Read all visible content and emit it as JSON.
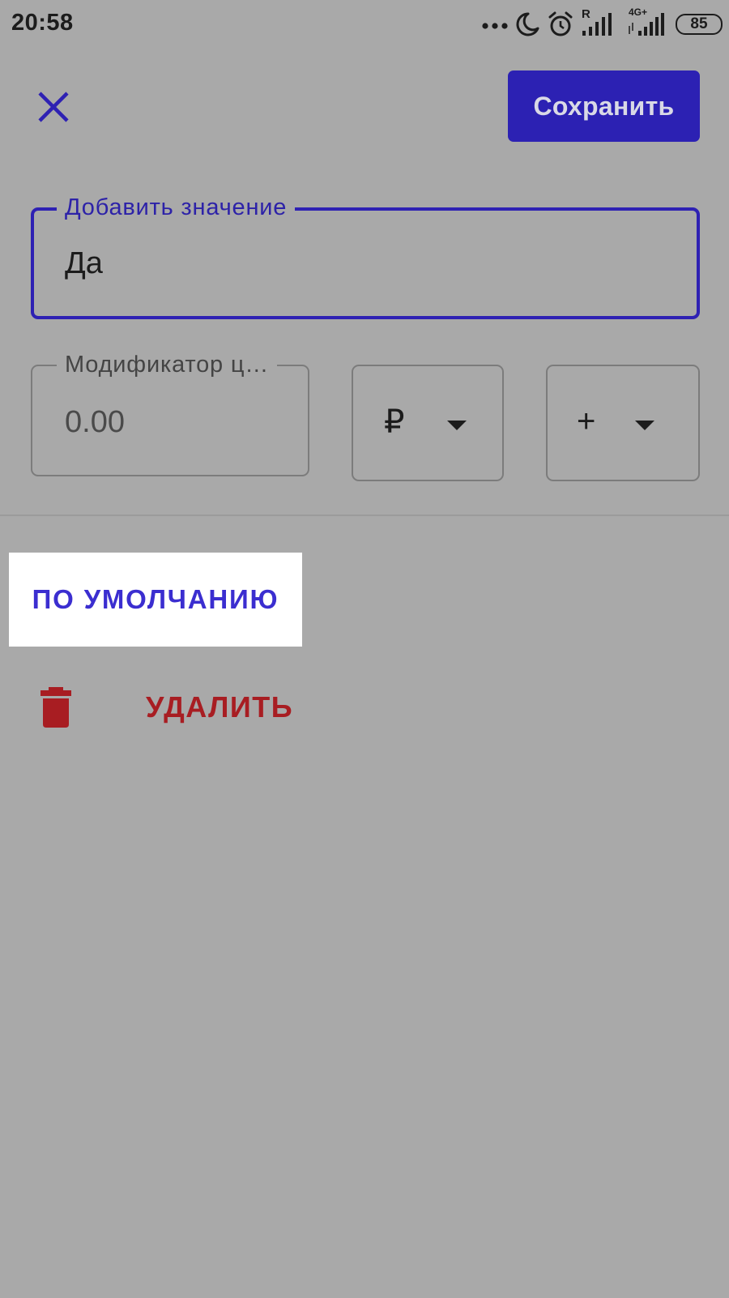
{
  "status_bar": {
    "time": "20:58",
    "icons": [
      "more-dots-icon",
      "moon-icon",
      "alarm-icon",
      "signal-roaming-icon",
      "signal-4g-icon"
    ],
    "network_roaming": "R",
    "network_type": "4G+",
    "battery": "85"
  },
  "header": {
    "close_icon": "close-icon",
    "save_label": "Сохранить"
  },
  "value_field": {
    "label": "Добавить значение",
    "value": "Да"
  },
  "modifier_field": {
    "label": "Модификатор ц…",
    "value": "0.00"
  },
  "currency_select": {
    "selected": "₽",
    "icon": "caret-down-icon"
  },
  "sign_select": {
    "selected": "+",
    "icon": "caret-down-icon"
  },
  "actions": {
    "default_label": "ПО УМОЛЧАНИЮ",
    "delete_label": "УДАЛИТЬ",
    "delete_icon": "trash-icon"
  },
  "colors": {
    "accent": "#2c21b3",
    "delete": "#a81d22",
    "background": "#a9a9a9"
  }
}
